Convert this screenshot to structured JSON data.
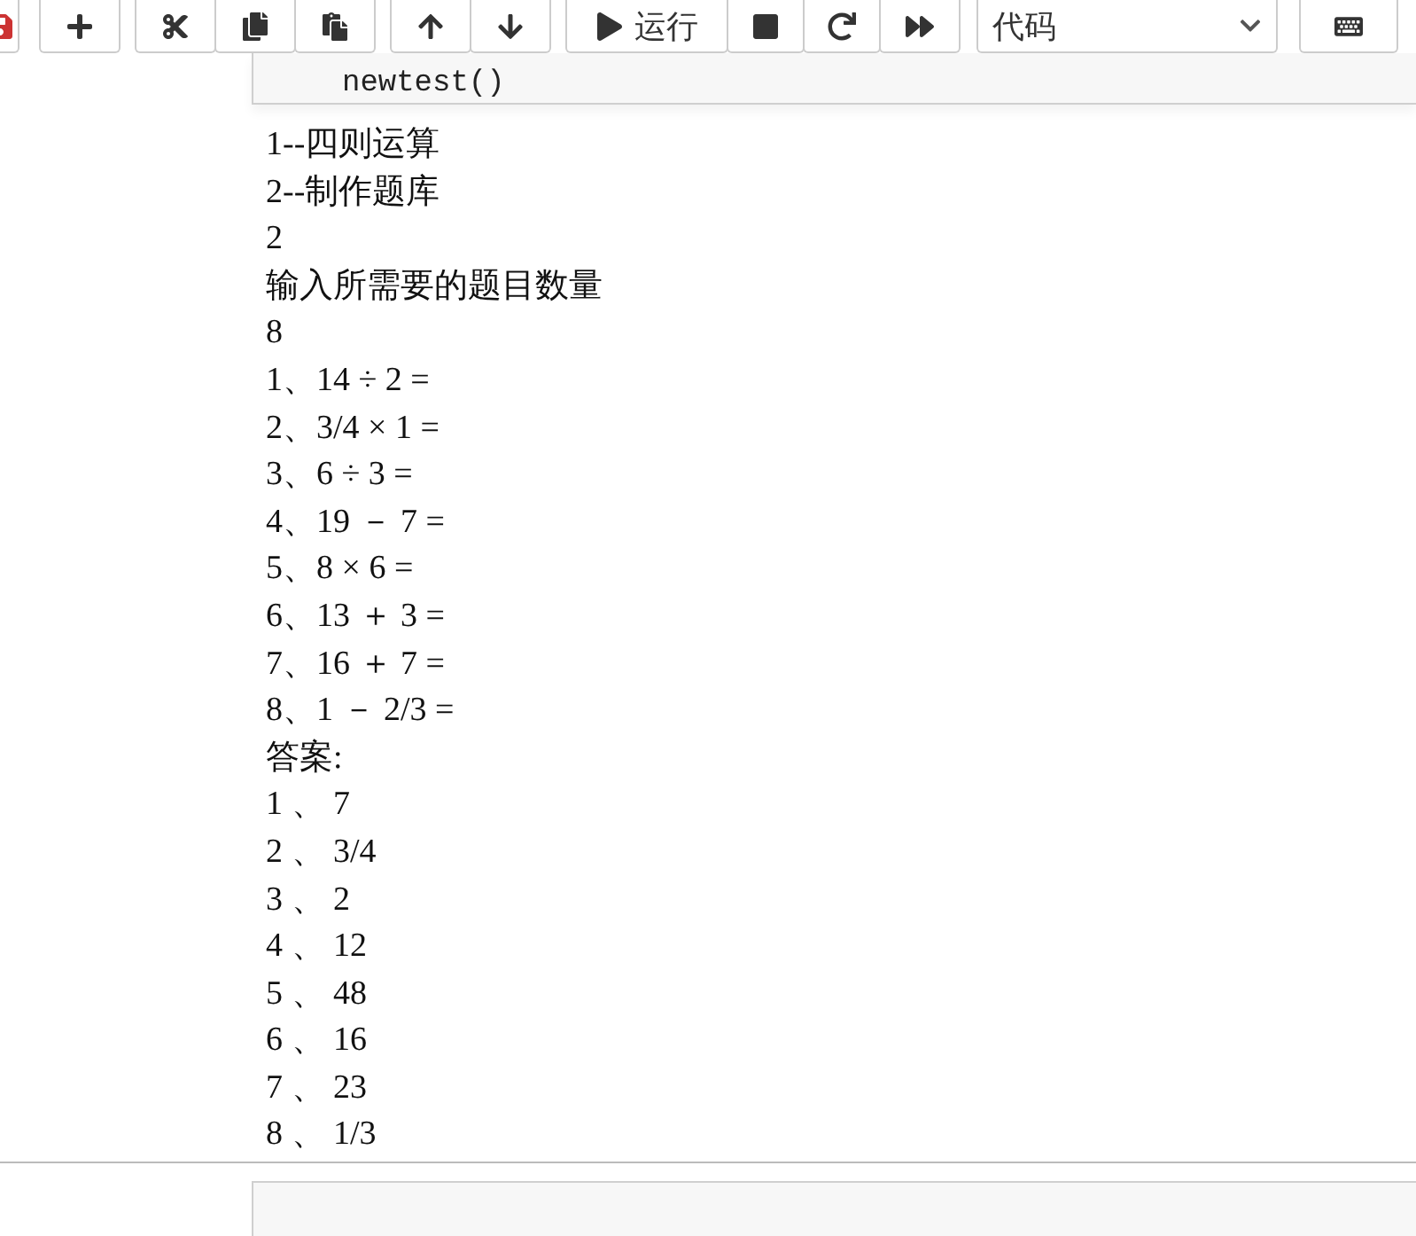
{
  "toolbar": {
    "run_label": "运行",
    "cell_type": "代码"
  },
  "code_cell": {
    "source": "newtest()"
  },
  "output": {
    "lines": [
      "1--四则运算",
      "2--制作题库",
      "2",
      "输入所需要的题目数量",
      "8",
      "1、14 ÷ 2 =",
      "2、3/4 × 1 =",
      "3、6 ÷ 3 =",
      "4、19 － 7 =",
      "5、8 × 6 =",
      "6、13 ＋ 3 =",
      "7、16 ＋ 7 =",
      "8、1 － 2/3 =",
      "答案:",
      "1 、 7",
      "2 、 3/4",
      "3 、 2",
      "4 、 12",
      "5 、 48",
      "6 、 16",
      "7 、 23",
      "8 、 1/3"
    ]
  }
}
